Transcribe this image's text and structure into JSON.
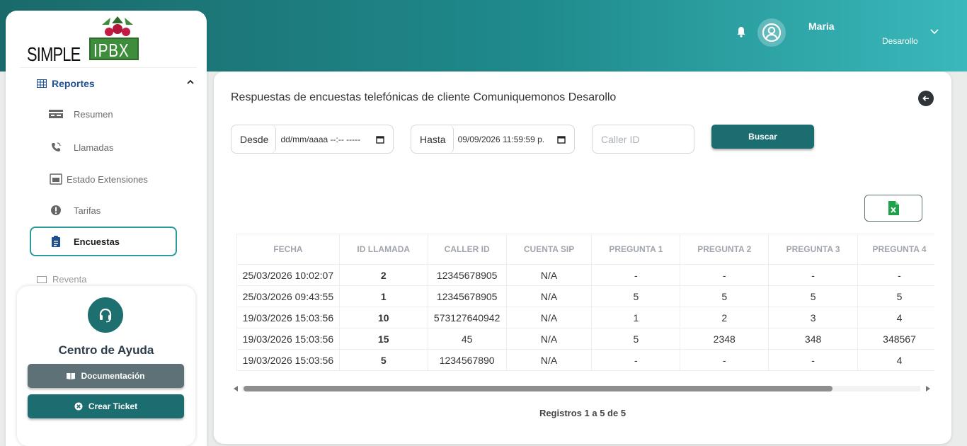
{
  "brand": {
    "logo_left": "SIMPLE",
    "logo_right": "IPBX"
  },
  "header": {
    "user_name": "Maria",
    "user_role": "Desarollo"
  },
  "sidebar": {
    "section": "Reportes",
    "items": [
      {
        "label": "Resumen",
        "icon": "card-icon"
      },
      {
        "label": "Llamadas",
        "icon": "phone-icon"
      },
      {
        "label": "Estado Extensiones",
        "icon": "device-icon"
      },
      {
        "label": "Tarifas",
        "icon": "alert-icon"
      },
      {
        "label": "Encuestas",
        "icon": "clipboard-icon",
        "active": true
      }
    ],
    "next_section": "Reventa"
  },
  "help": {
    "title": "Centro de Ayuda",
    "doc_label": "Documentación",
    "ticket_label": "Crear Ticket"
  },
  "main": {
    "title": "Respuestas de encuestas telefónicas de cliente Comuniquemonos Desarollo",
    "desde_label": "Desde",
    "desde_value": "dd/mm/aaaa --:-- -----",
    "hasta_label": "Hasta",
    "hasta_value": "09/09/2026 11:59:59 p.",
    "caller_placeholder": "Caller ID",
    "buscar_label": "Buscar",
    "registros": "Registros 1 a 5 de 5"
  },
  "table": {
    "columns": [
      "FECHA",
      "ID LLAMADA",
      "CALLER ID",
      "CUENTA SIP",
      "PREGUNTA 1",
      "PREGUNTA 2",
      "PREGUNTA 3",
      "PREGUNTA 4"
    ],
    "rows": [
      [
        "25/03/2026 10:02:07",
        "2",
        "12345678905",
        "N/A",
        "-",
        "-",
        "-",
        "-"
      ],
      [
        "25/03/2026 09:43:55",
        "1",
        "12345678905",
        "N/A",
        "5",
        "5",
        "5",
        "5"
      ],
      [
        "19/03/2026 15:03:56",
        "10",
        "573127640942",
        "N/A",
        "1",
        "2",
        "3",
        "4"
      ],
      [
        "19/03/2026 15:03:56",
        "15",
        "45",
        "N/A",
        "5",
        "2348",
        "348",
        "348567"
      ],
      [
        "19/03/2026 15:03:56",
        "5",
        "1234567890",
        "N/A",
        "-",
        "-",
        "-",
        "4"
      ]
    ]
  },
  "colors": {
    "primary": "#1b6d70",
    "header_start": "#1a6a6b",
    "header_end": "#3ab8bb",
    "nav_accent": "#1e4f8e"
  }
}
